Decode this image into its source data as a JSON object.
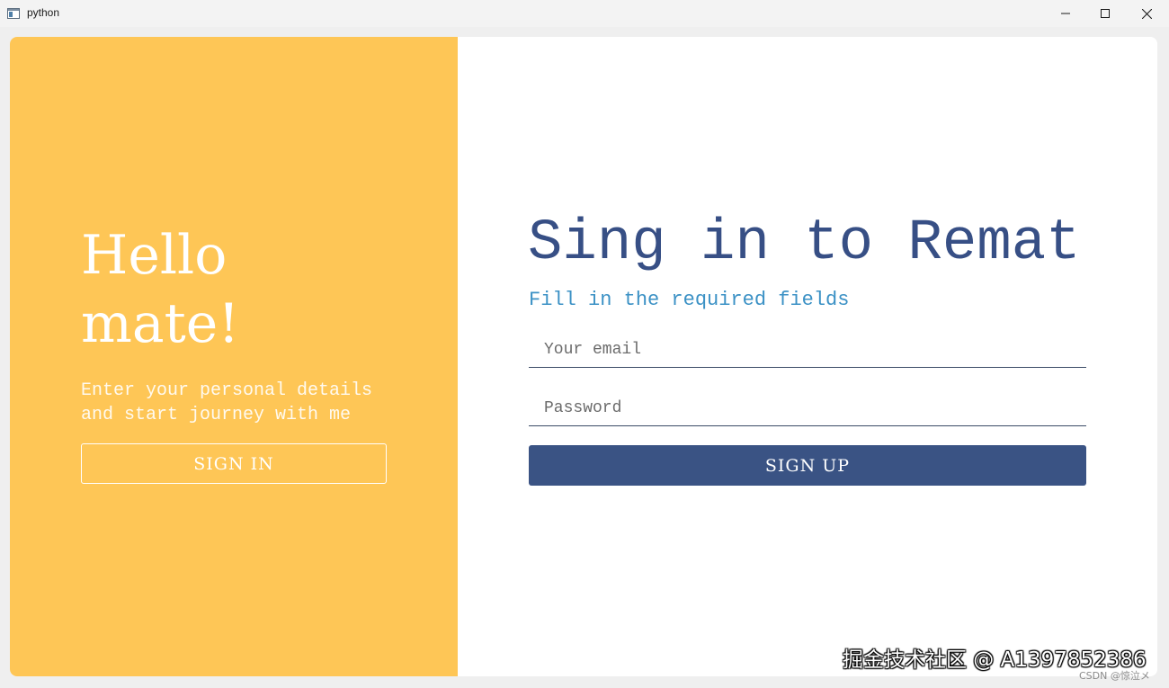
{
  "window": {
    "title": "python",
    "icon": "app-window-icon"
  },
  "left_panel": {
    "title": "Hello\nmate!",
    "text": "Enter your personal details\nand start journey with me",
    "sign_in_label": "SIGN IN",
    "background": "#fec656"
  },
  "right_panel": {
    "title": "Sing in to Remat",
    "subtitle": "Fill in the required fields",
    "email_placeholder": "Your email",
    "password_placeholder": "Password",
    "sign_up_label": "SIGN UP",
    "accent": "#3a5384",
    "subtitle_color": "#3b91c5"
  },
  "watermark": {
    "main": "掘金技术社区 @ A1397852386",
    "small": "CSDN @惊泣メ"
  }
}
